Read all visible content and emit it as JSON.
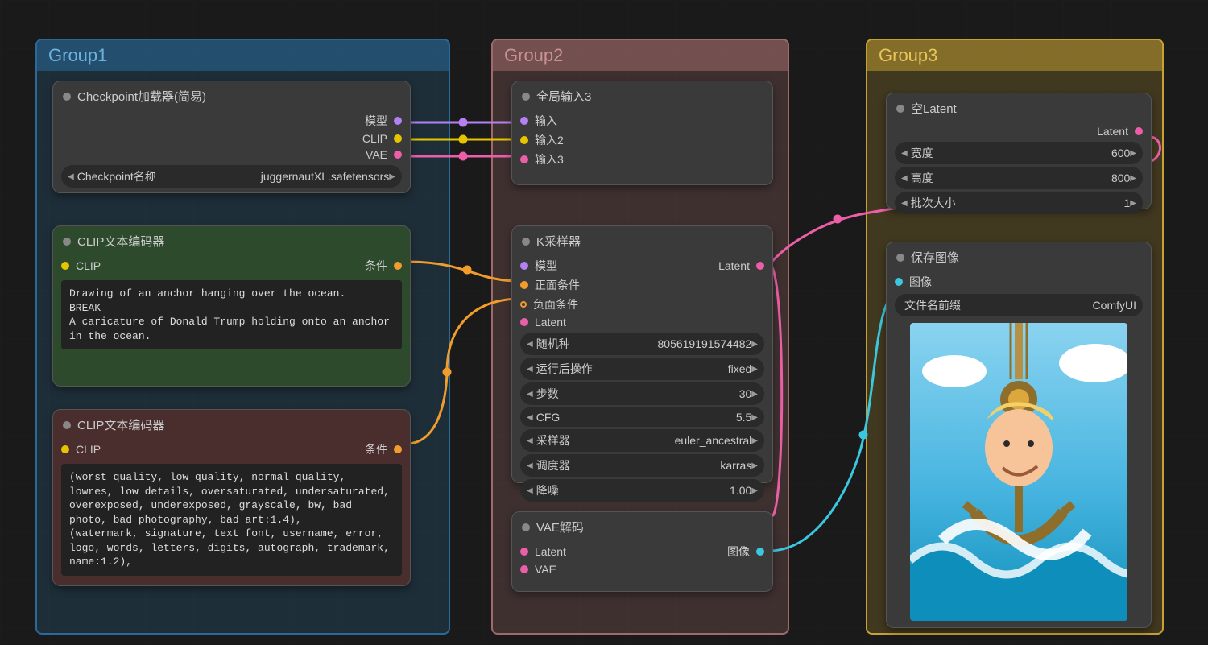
{
  "groups": {
    "g1": "Group1",
    "g2": "Group2",
    "g3": "Group3"
  },
  "checkpoint": {
    "title": "Checkpoint加载器(简易)",
    "out_model": "模型",
    "out_clip": "CLIP",
    "out_vae": "VAE",
    "widget_label": "Checkpoint名称",
    "widget_value": "juggernautXL.safetensors"
  },
  "clip_pos": {
    "title": "CLIP文本编码器",
    "in_clip": "CLIP",
    "out_cond": "条件",
    "text": "Drawing of an anchor hanging over the ocean.\nBREAK\nA caricature of Donald Trump holding onto an anchor in the ocean."
  },
  "clip_neg": {
    "title": "CLIP文本编码器",
    "in_clip": "CLIP",
    "out_cond": "条件",
    "text": "(worst quality, low quality, normal quality, lowres, low details, oversaturated, undersaturated, overexposed, underexposed, grayscale, bw, bad photo, bad photography, bad art:1.4),\n(watermark, signature, text font, username, error, logo, words, letters, digits, autograph, trademark, name:1.2),"
  },
  "global_in": {
    "title": "全局输入3",
    "p1": "输入",
    "p2": "输入2",
    "p3": "输入3"
  },
  "ksampler": {
    "title": "K采样器",
    "in_model": "模型",
    "in_pos": "正面条件",
    "in_neg": "负面条件",
    "in_latent": "Latent",
    "out_latent": "Latent",
    "seed_l": "随机种",
    "seed_v": "805619191574482",
    "after_l": "运行后操作",
    "after_v": "fixed",
    "steps_l": "步数",
    "steps_v": "30",
    "cfg_l": "CFG",
    "cfg_v": "5.5",
    "sampler_l": "采样器",
    "sampler_v": "euler_ancestral",
    "sched_l": "调度器",
    "sched_v": "karras",
    "denoise_l": "降噪",
    "denoise_v": "1.00"
  },
  "vae_decode": {
    "title": "VAE解码",
    "in_latent": "Latent",
    "in_vae": "VAE",
    "out_img": "图像"
  },
  "empty_latent": {
    "title": "空Latent",
    "out_latent": "Latent",
    "w_l": "宽度",
    "w_v": "600",
    "h_l": "高度",
    "h_v": "800",
    "b_l": "批次大小",
    "b_v": "1"
  },
  "save_image": {
    "title": "保存图像",
    "in_img": "图像",
    "prefix_l": "文件名前缀",
    "prefix_v": "ComfyUI"
  }
}
